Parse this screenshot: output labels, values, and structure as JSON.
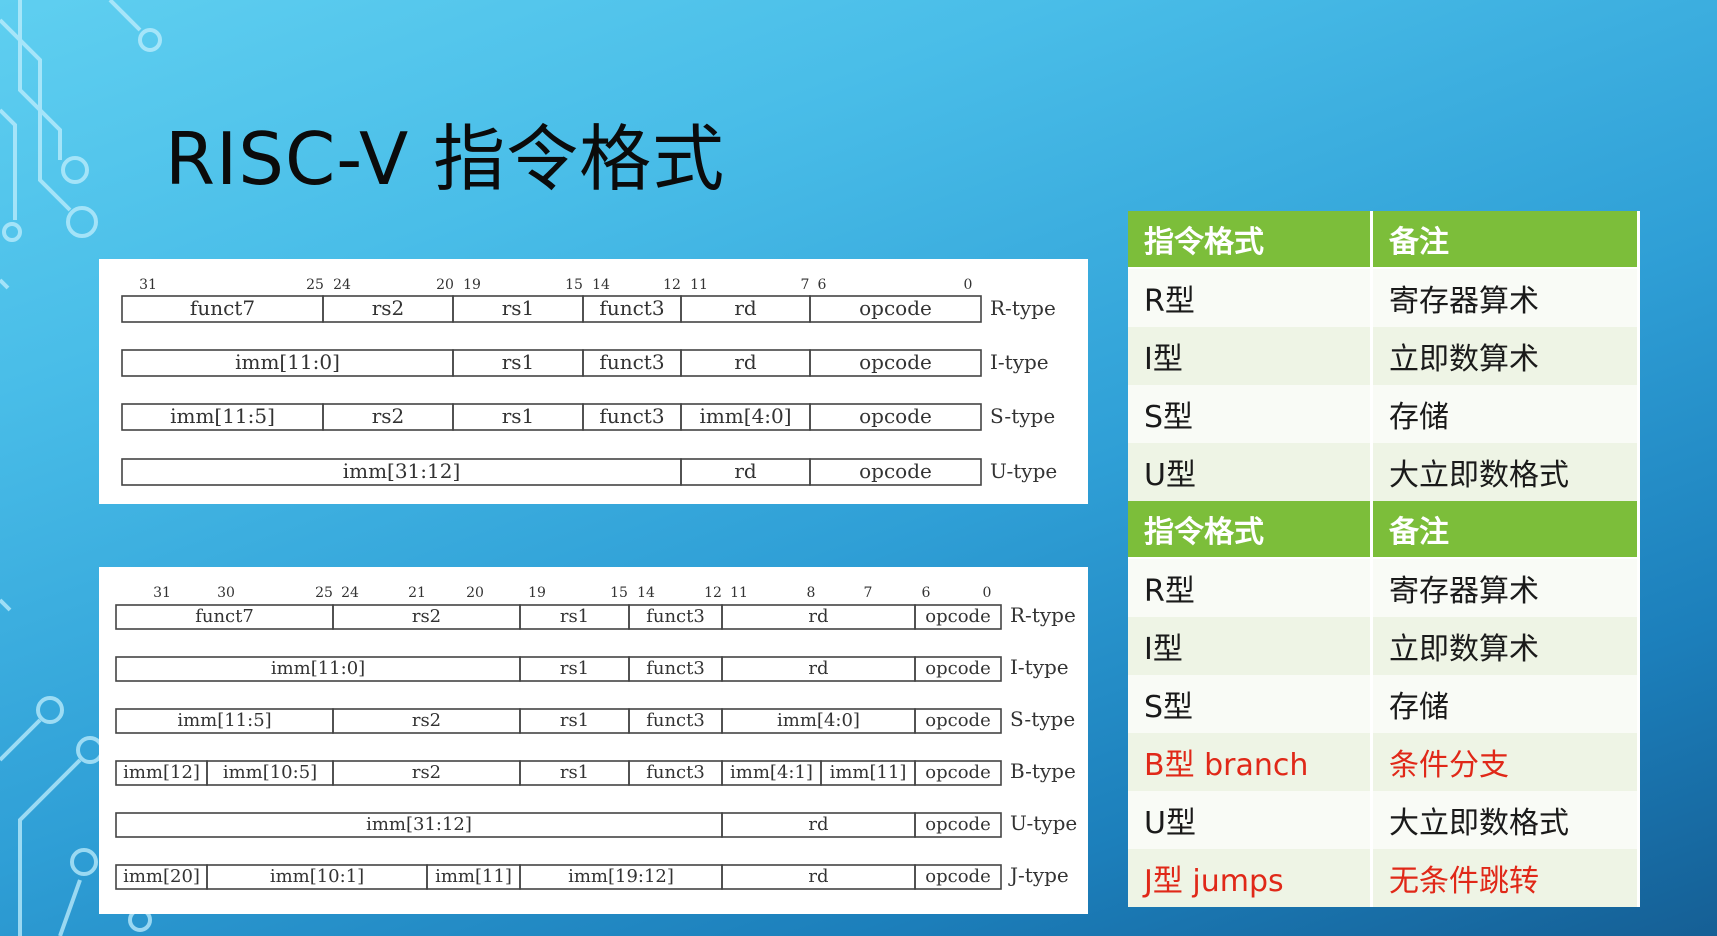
{
  "slide": {
    "title": "RISC-V 指令格式"
  },
  "diagram_top": {
    "bit_numbers": [
      "31",
      "25",
      "24",
      "20",
      "19",
      "15",
      "14",
      "12",
      "11",
      "7",
      "6",
      "0"
    ],
    "rows": [
      {
        "type": "R-type",
        "fields": [
          "funct7",
          "rs2",
          "rs1",
          "funct3",
          "rd",
          "opcode"
        ]
      },
      {
        "type": "I-type",
        "fields": [
          "imm[11:0]",
          "rs1",
          "funct3",
          "rd",
          "opcode"
        ]
      },
      {
        "type": "S-type",
        "fields": [
          "imm[11:5]",
          "rs2",
          "rs1",
          "funct3",
          "imm[4:0]",
          "opcode"
        ]
      },
      {
        "type": "U-type",
        "fields": [
          "imm[31:12]",
          "rd",
          "opcode"
        ]
      }
    ]
  },
  "diagram_bottom": {
    "bit_numbers": [
      "31",
      "30",
      "25",
      "24",
      "21",
      "20",
      "19",
      "15",
      "14",
      "12",
      "11",
      "8",
      "7",
      "6",
      "0"
    ],
    "rows": [
      {
        "type": "R-type",
        "fields": [
          "funct7",
          "rs2",
          "rs1",
          "funct3",
          "rd",
          "opcode"
        ]
      },
      {
        "type": "I-type",
        "fields": [
          "imm[11:0]",
          "rs1",
          "funct3",
          "rd",
          "opcode"
        ]
      },
      {
        "type": "S-type",
        "fields": [
          "imm[11:5]",
          "rs2",
          "rs1",
          "funct3",
          "imm[4:0]",
          "opcode"
        ]
      },
      {
        "type": "B-type",
        "fields": [
          "imm[12]",
          "imm[10:5]",
          "rs2",
          "rs1",
          "funct3",
          "imm[4:1]",
          "imm[11]",
          "opcode"
        ]
      },
      {
        "type": "U-type",
        "fields": [
          "imm[31:12]",
          "rd",
          "opcode"
        ]
      },
      {
        "type": "J-type",
        "fields": [
          "imm[20]",
          "imm[10:1]",
          "imm[11]",
          "imm[19:12]",
          "rd",
          "opcode"
        ]
      }
    ]
  },
  "notes_table": {
    "header": [
      "指令格式",
      "备注"
    ],
    "rows_a": [
      [
        "R型",
        "寄存器算术"
      ],
      [
        "I型",
        "立即数算术"
      ],
      [
        "S型",
        "存储"
      ],
      [
        "U型",
        "大立即数格式"
      ]
    ],
    "header2": [
      "指令格式",
      "备注"
    ],
    "rows_b": [
      [
        "R型",
        "寄存器算术"
      ],
      [
        "I型",
        "立即数算术"
      ],
      [
        "S型",
        "存储"
      ],
      [
        "B型 branch",
        "条件分支"
      ],
      [
        "U型",
        "大立即数格式"
      ],
      [
        "J型 jumps",
        "无条件跳转"
      ]
    ]
  },
  "colors": {
    "table_header": "#7cbe3a",
    "highlight_red": "#e02818"
  }
}
